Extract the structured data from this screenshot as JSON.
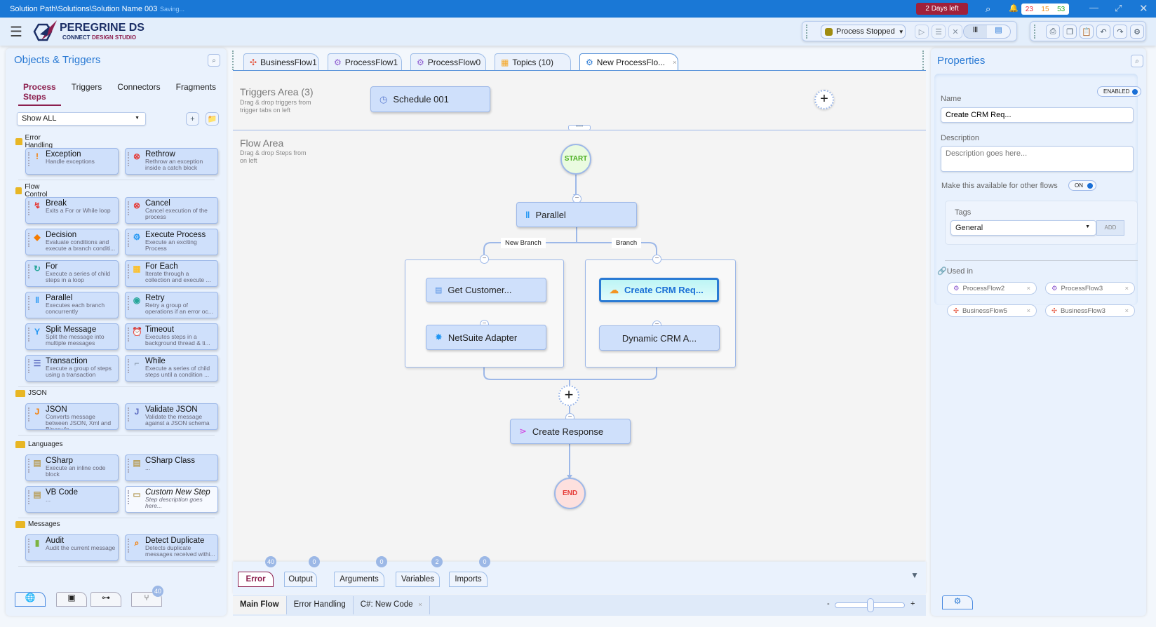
{
  "titlebar": {
    "path": "Solution Path\\Solutions\\Solution Name 003",
    "status": "Saving...",
    "trial": "2 Days left",
    "counts": {
      "red": "23",
      "orange": "15",
      "green": "53"
    },
    "colors": {
      "bar": "#1a78d6",
      "trial": "#a0203a"
    }
  },
  "logo": {
    "name": "PEREGRINE DS",
    "sub1": "CONNECT",
    "sub2": "DESIGN STUDIO"
  },
  "toolbar": {
    "process_status": "Process Stopped"
  },
  "left": {
    "title": "Objects & Triggers",
    "tabs": [
      "Process Steps",
      "Triggers",
      "Connectors",
      "Fragments"
    ],
    "filter": "Show ALL",
    "categories": [
      {
        "name": "Error Handling",
        "items": [
          {
            "title": "Exception",
            "desc": "Handle exceptions",
            "icon": "exclamation-icon"
          },
          {
            "title": "Rethrow",
            "desc": "Rethrow an exception inside a catch block",
            "icon": "rethrow-icon"
          }
        ]
      },
      {
        "name": "Flow Control",
        "items": [
          {
            "title": "Break",
            "desc": "Exits a For or While loop",
            "icon": "break-icon"
          },
          {
            "title": "Cancel",
            "desc": "Cancel execution of the process",
            "icon": "cancel-icon"
          },
          {
            "title": "Decision",
            "desc": "Evaluate conditions and execute a branch conditi...",
            "icon": "decision-icon"
          },
          {
            "title": "Execute Process",
            "desc": "Execute an exciting Process",
            "icon": "gears-icon"
          },
          {
            "title": "For",
            "desc": "Execute a series of child steps in a loop",
            "icon": "loop-icon"
          },
          {
            "title": "For Each",
            "desc": "Iterate through a collection and execute ...",
            "icon": "foreach-icon"
          },
          {
            "title": "Parallel",
            "desc": "Executes each branch concurrently",
            "icon": "parallel-icon"
          },
          {
            "title": "Retry",
            "desc": "Retry a group of operations if an error oc...",
            "icon": "retry-icon"
          },
          {
            "title": "Split Message",
            "desc": "Split the message into multiple messages",
            "icon": "split-icon"
          },
          {
            "title": "Timeout",
            "desc": "Executes steps in a background thread & ti...",
            "icon": "alarm-icon"
          },
          {
            "title": "Transaction",
            "desc": "Execute a group of steps using a transaction",
            "icon": "database-icon"
          },
          {
            "title": "While",
            "desc": "Execute a series of child steps until a condition ...",
            "icon": "while-icon"
          }
        ]
      },
      {
        "name": "JSON",
        "items": [
          {
            "title": "JSON",
            "desc": "Converts message between JSON, Xml and Binary fo...",
            "icon": "json-icon"
          },
          {
            "title": "Validate JSON",
            "desc": "Validate the message against a JSON schema",
            "icon": "validate-json-icon"
          }
        ]
      },
      {
        "name": "Languages",
        "items": [
          {
            "title": "CSharp",
            "desc": "Execute an inline code block",
            "icon": "csharp-icon"
          },
          {
            "title": "CSharp Class",
            "desc": "...",
            "icon": "csharp-class-icon"
          },
          {
            "title": "VB Code",
            "desc": "...",
            "icon": "vb-icon"
          },
          {
            "title": "Custom New Step",
            "desc": "Step description goes here...",
            "icon": "custom-step-icon",
            "custom": true
          }
        ]
      },
      {
        "name": "Messages",
        "items": [
          {
            "title": "Audit",
            "desc": "Audit the current message",
            "icon": "audit-icon"
          },
          {
            "title": "Detect Duplicate",
            "desc": "Detects duplicate messages received withi...",
            "icon": "detect-duplicate-icon"
          }
        ]
      }
    ],
    "bottom_badge": "40"
  },
  "doc_tabs": [
    "BusinessFlow1",
    "ProcessFlow1",
    "ProcessFlow0",
    "Topics (10)",
    "New ProcessFlo..."
  ],
  "canvas": {
    "triggers_title": "Triggers Area (3)",
    "triggers_hint": "Drag & drop triggers from trigger tabs on left",
    "trigger": "Schedule 001",
    "flow_title": "Flow Area",
    "flow_hint": "Drag & drop Steps from on left",
    "start": "START",
    "end": "END",
    "parallel": "Parallel",
    "branch_left": "New Branch",
    "branch_right": "Branch",
    "left_steps": [
      "Get Customer...",
      "NetSuite Adapter"
    ],
    "right_steps": [
      "Create CRM Req...",
      "Dynamic CRM A..."
    ],
    "response": "Create Response"
  },
  "bottom": {
    "tabs": [
      {
        "label": "Error",
        "count": "40"
      },
      {
        "label": "Output",
        "count": "0"
      },
      {
        "label": "Arguments",
        "count": "0"
      },
      {
        "label": "Variables",
        "count": "2"
      },
      {
        "label": "Imports",
        "count": "0"
      }
    ],
    "flow_tabs": [
      "Main Flow",
      "Error Handling",
      "C#: New Code"
    ],
    "zoom_minus": "-",
    "zoom_plus": "+",
    "zoom_level": 0.5
  },
  "props": {
    "title": "Properties",
    "enabled": "ENABLED",
    "name_label": "Name",
    "name_value": "Create CRM Req...",
    "desc_label": "Description",
    "desc_placeholder": "Description goes here...",
    "available_label": "Make this available for other flows",
    "available_toggle": "ON",
    "tags_label": "Tags",
    "tag_value": "General",
    "add": "ADD",
    "used_in": "Used in",
    "used_items": [
      {
        "label": "ProcessFlow2",
        "icon": "process-flow-icon"
      },
      {
        "label": "ProcessFlow3",
        "icon": "process-flow-icon"
      },
      {
        "label": "BusinessFlow5",
        "icon": "business-flow-icon"
      },
      {
        "label": "BusinessFlow3",
        "icon": "business-flow-icon"
      }
    ]
  }
}
